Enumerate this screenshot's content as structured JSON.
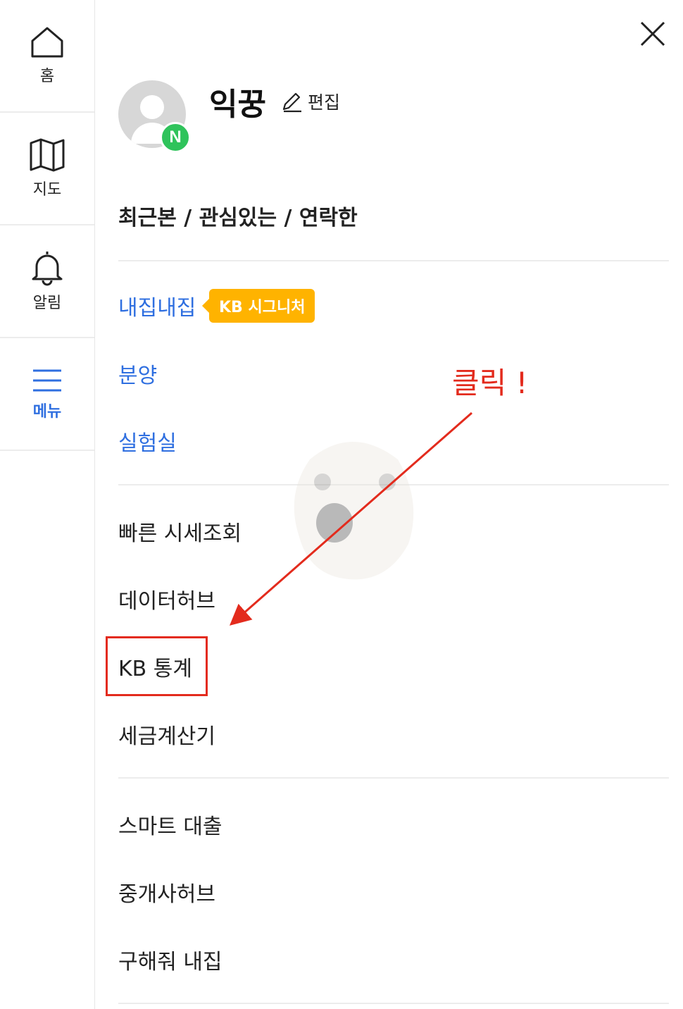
{
  "rail": {
    "items": [
      {
        "label": "홈",
        "icon": "home-icon"
      },
      {
        "label": "지도",
        "icon": "map-icon"
      },
      {
        "label": "알림",
        "icon": "bell-icon"
      },
      {
        "label": "메뉴",
        "icon": "menu-icon",
        "active": true
      }
    ]
  },
  "profile": {
    "name": "익꿍",
    "edit_label": "편집",
    "badge_letter": "N"
  },
  "recent_link": "최근본 / 관심있는 / 연락한",
  "menu": {
    "group1": [
      {
        "label": "내집내집",
        "badge": "KB 시그니처"
      },
      {
        "label": "분양"
      },
      {
        "label": "실험실"
      }
    ],
    "group2": [
      {
        "label": "빠른 시세조회"
      },
      {
        "label": "데이터허브"
      },
      {
        "label": "KB 통계"
      },
      {
        "label": "세금계산기"
      }
    ],
    "group3": [
      {
        "label": "스마트 대출"
      },
      {
        "label": "중개사허브"
      },
      {
        "label": "구해줘 내집"
      }
    ]
  },
  "annotation": {
    "text": "클릭 !"
  },
  "colors": {
    "accent_blue": "#2f6fe0",
    "badge_yellow": "#ffb300",
    "annotation_red": "#e32b1d",
    "naver_green": "#2fc35b"
  }
}
